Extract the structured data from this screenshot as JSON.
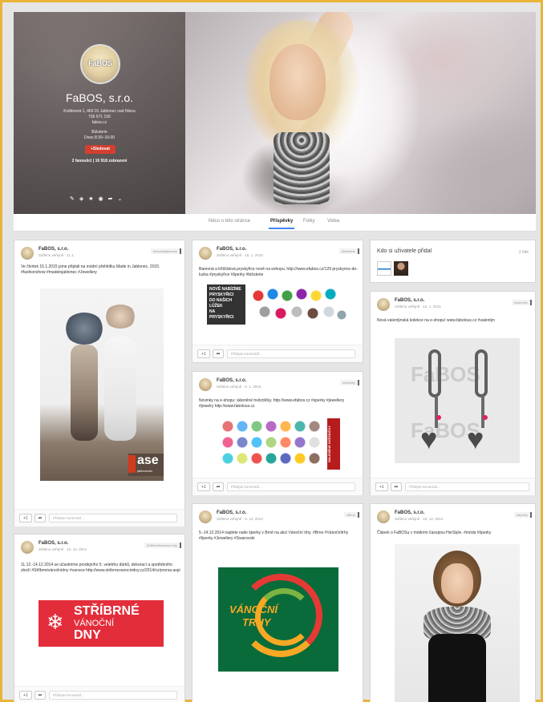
{
  "profile": {
    "name": "FaBOS, s.r.o.",
    "avatar_text": "FaBOS",
    "address": "Květinová 1, 466 01 Jablonec nad Nisou",
    "phone": "736 671 156",
    "website": "fabos.cz",
    "category": "Bižuterie",
    "hours": "Dnes 8:30–16:00",
    "follow_label": "Sledovat",
    "stats": "2 fanoušci | 16 918 zobrazení"
  },
  "tabs": [
    "Něco o této stránce",
    "Příspěvky",
    "Fotky",
    "Videa"
  ],
  "comment_placeholder": "Přidejte komentář...",
  "plus_label": "+1",
  "posts": [
    {
      "author": "FaBOS, s.r.o.",
      "meta": "Sdíleno veřejně  ·  11.1.",
      "tag": "#madeinjablonec",
      "text": "Ve čtvrtek 15.1.2015 jsme připlali na módní přehlídku Made in Jablonec, 2015. #fashionshow #madeinjablonec #Jewellery",
      "logo": "ase",
      "logo_sub": "jablonecko"
    },
    {
      "author": "FaBOS, s.r.o.",
      "meta": "Sdíleno veřejně  ·  13. 12. 2014",
      "tag": "#Stříbrnévánoční dny",
      "text": "11.12.-14.12.2014 se účastníme prodejního 5. veletrhu dárků, dekorací a spotřebního zboží #Stříbrnévánočnídny #vanoce http://www.stribrnevanocnidny.cz/2014/cz/prorsa.aspi",
      "logo_l1": "STŘÍBRNÉ",
      "logo_l2": "VÁNOČNÍ",
      "logo_l3": "DNY"
    },
    {
      "author": "FaBOS, s.r.o.",
      "meta": "Sdíleno veřejně  ·  16. 1. 2015",
      "tag": "#bižuterie",
      "text": "Barevná a křišťálová pryskyřice nově na eshopu. http://www.efabos.cz/129 pryskyrice-do-luzka #pryskyřice #šperky #bižuterie",
      "banner": [
        "NOVĚ NABÍZÍME",
        "PRYSKYŘICI",
        "DO NAŠICH",
        "LŮŽEK",
        "NA",
        "PRYSKYŘICI"
      ]
    },
    {
      "author": "FaBOS, s.r.o.",
      "meta": "Sdíleno veřejně  ·  8. 1. 2015",
      "tag": "#Jewelry",
      "text": "Novinky na e-shopu: skleněné hvězdičky. http://www.efabos.cz  #sperky #jewellery #jewelry http://www.fabolous.cz",
      "banner": "SKLENĚNÉ HVĚZDIČKY"
    },
    {
      "author": "FaBOS, s.r.o.",
      "meta": "Sdíleno veřejně  ·  9. 12. 2014",
      "tag": "#Brno",
      "text": "5.-14.12.2014 najdete naše šperky v Brně na akci Vánoční trhy. #Brno #Vánočnítrhy #šperky #Jewellery #Swarovski",
      "logo_l1": "VÁNOČNÍ",
      "logo_l2": "TRHY"
    },
    {
      "title": "Kdo si uživatele přidal",
      "count": "2 lidé"
    },
    {
      "author": "FaBOS, s.r.o.",
      "meta": "Sdíleno veřejně  ·  12. 1. 2015",
      "tag": "#valentýn",
      "text": "Nová valentýnská kolekce na e-shopu! www.fabolous.cz #valentýn",
      "watermark": "FaBOS"
    },
    {
      "author": "FaBOS, s.r.o.",
      "meta": "Sdíleno veřejně  ·  15. 12. 2014",
      "tag": "#šperky",
      "text": "Článek o FaBOSu v módním časopisu HerStyle. #móda #šperky"
    }
  ]
}
